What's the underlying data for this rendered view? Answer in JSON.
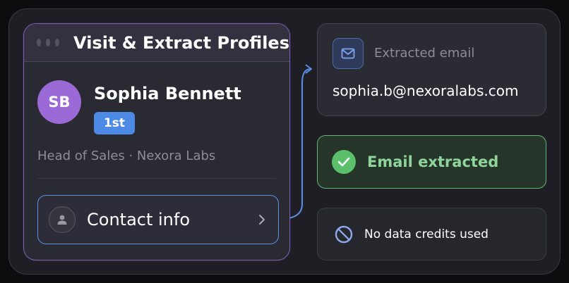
{
  "card": {
    "title": "Visit & Extract Profiles",
    "window_dots": 3
  },
  "profile": {
    "initials": "SB",
    "name": "Sophia Bennett",
    "degree": "1st",
    "headline": "Head of Sales · Nexora Labs",
    "contact_button_label": "Contact info"
  },
  "extracted": {
    "label": "Extracted email",
    "email": "sophia.b@nexoralabs.com"
  },
  "status": {
    "label": "Email extracted"
  },
  "credits": {
    "label": "No data credits used"
  },
  "colors": {
    "accent_purple": "#7a5fb0",
    "avatar": "#9b6ad6",
    "badge_blue": "#4c8ae6",
    "connector_blue": "#5b8fe6",
    "success_green": "#5cbf6c"
  },
  "icons": [
    "window-dots-icon",
    "user-icon",
    "chevron-right-icon",
    "mail-icon",
    "check-icon",
    "ban-icon"
  ]
}
